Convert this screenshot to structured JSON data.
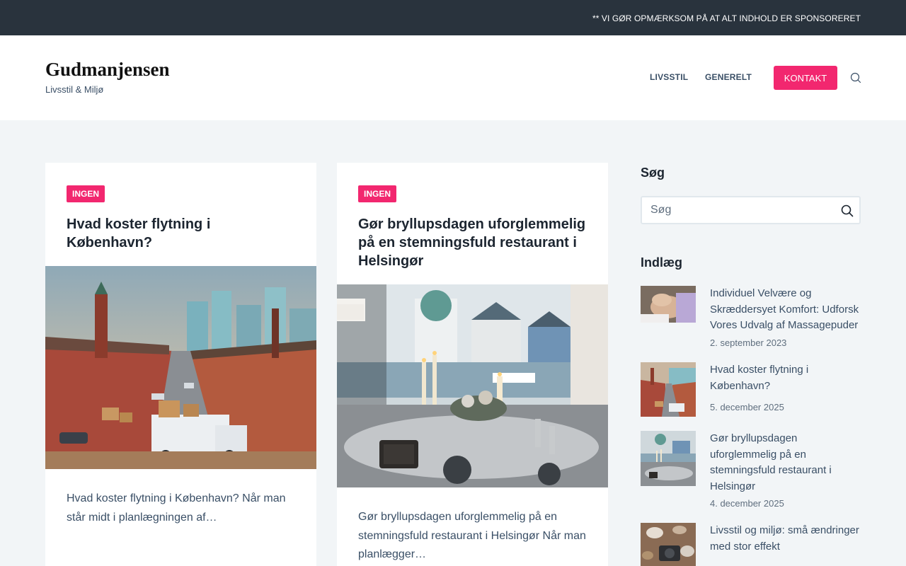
{
  "topbar": {
    "notice": "** VI GØR OPMÆRKSOM PÅ AT ALT INDHOLD ER SPONSORERET"
  },
  "header": {
    "site_title": "Gudmanjensen",
    "tagline": "Livsstil & Miljø",
    "nav": [
      "LIVSSTIL",
      "GENERELT"
    ],
    "contact_label": "KONTAKT",
    "accent_color": "#f2276f"
  },
  "cards": [
    {
      "category": "INGEN",
      "title": "Hvad koster flytning i København?",
      "excerpt": "Hvad koster flytning i København? Når man står midt i planlægningen af…",
      "image": "copenhagen-street-moving-boxes"
    },
    {
      "category": "INGEN",
      "title": "Gør bryllupsdagen uforglemmelig på en stemningsfuld restaurant i Helsingør",
      "excerpt": "Gør bryllupsdagen uforglemmelig på en stemningsfuld restaurant i Helsingør Når man planlægger…",
      "image": "restaurant-table-reserved-sign"
    }
  ],
  "sidebar": {
    "search_title": "Søg",
    "search_placeholder": "Søg",
    "posts_title": "Indlæg",
    "posts": [
      {
        "title": "Individuel Velvære og Skræddersyet Komfort: Udforsk Vores Udvalg af Massagepuder",
        "date": "2. september 2023",
        "image": "massage-thumbnail"
      },
      {
        "title": "Hvad koster flytning i København?",
        "date": "5. december 2025",
        "image": "copenhagen-thumbnail"
      },
      {
        "title": "Gør bryllupsdagen uforglemmelig på en stemningsfuld restaurant i Helsingør",
        "date": "4. december 2025",
        "image": "restaurant-thumbnail"
      },
      {
        "title": "Livsstil og miljø: små ændringer med stor effekt",
        "date": "",
        "image": "lifestyle-thumbnail"
      }
    ]
  }
}
